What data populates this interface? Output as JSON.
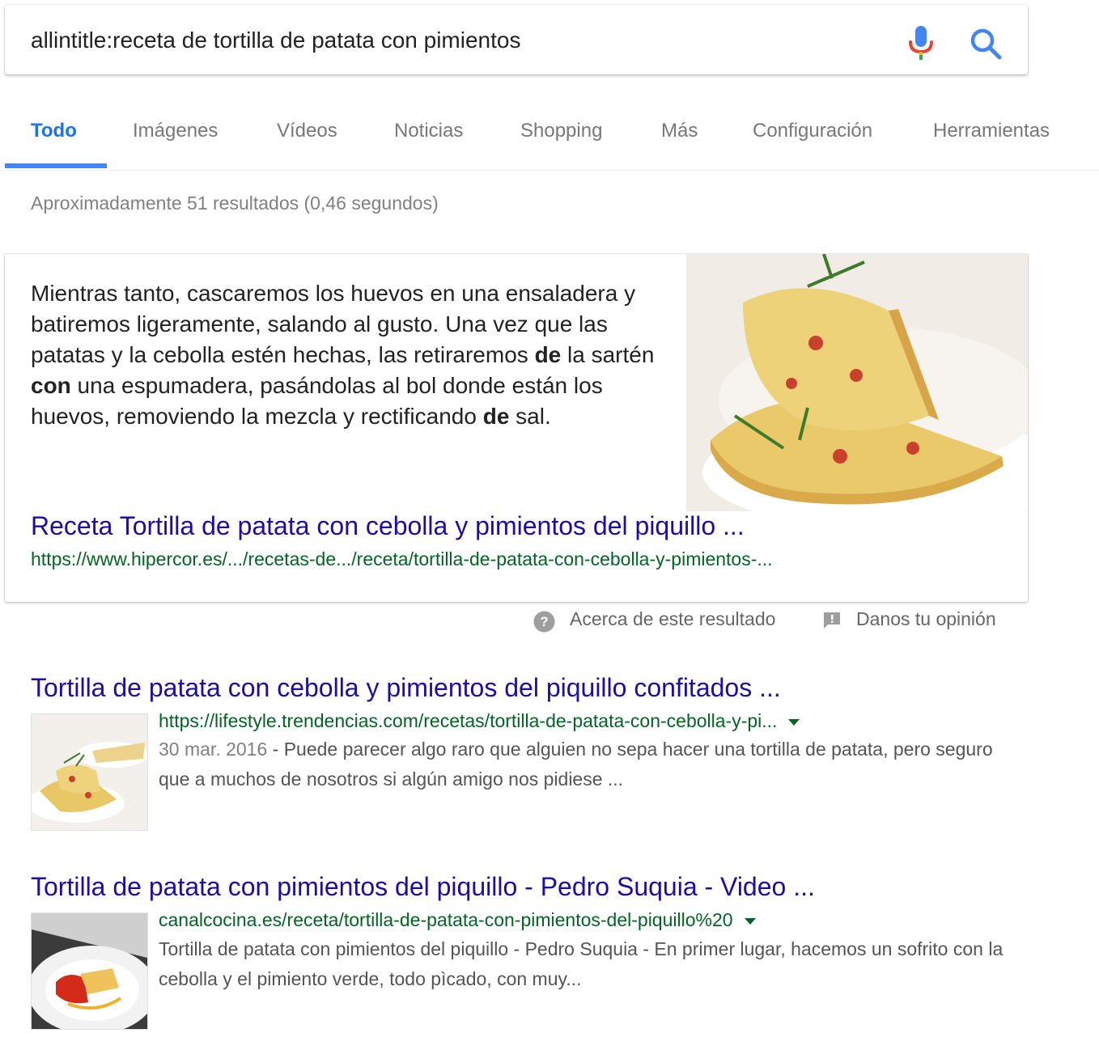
{
  "search": {
    "query": "allintitle:receta de tortilla de patata con pimientos"
  },
  "tabs": [
    {
      "label": "Todo",
      "active": true
    },
    {
      "label": "Imágenes"
    },
    {
      "label": "Vídeos"
    },
    {
      "label": "Noticias"
    },
    {
      "label": "Shopping"
    },
    {
      "label": "Más"
    },
    {
      "label": "Configuración"
    },
    {
      "label": "Herramientas"
    }
  ],
  "stats": "Aproximadamente 51 resultados (0,46 segundos)",
  "featured_snippet": {
    "text_parts": [
      "Mientras tanto, cascaremos los huevos en una ensaladera y batiremos ligeramente, salando al gusto. Una vez que las patatas y la cebolla estén hechas, las retiraremos ",
      "de",
      " la sartén ",
      "con",
      " una espumadera, pasándolas al bol donde están los huevos, removiendo la mezcla y rectificando ",
      "de",
      " sal."
    ],
    "title": "Receta Tortilla de patata con cebolla y pimientos del piquillo ...",
    "url": "https://www.hipercor.es/.../recetas-de.../receta/tortilla-de-patata-con-cebolla-y-pimientos-..."
  },
  "about": {
    "about_label": "Acerca de este resultado",
    "feedback_label": "Danos tu opinión"
  },
  "results": [
    {
      "title": "Tortilla de patata con cebolla y pimientos del piquillo confitados ...",
      "url": "https://lifestyle.trendencias.com/recetas/tortilla-de-patata-con-cebolla-y-pi...",
      "date": "30 mar. 2016",
      "separator": " - ",
      "description": "Puede parecer algo raro que alguien no sepa hacer una tortilla de patata, pero seguro que a muchos de nosotros si algún amigo nos pidiese ..."
    },
    {
      "title": "Tortilla de patata con pimientos del piquillo - Pedro Suquia - Video ...",
      "url": "canalcocina.es/receta/tortilla-de-patata-con-pimientos-del-piquillo%20",
      "description": "Tortilla de patata con pimientos del piquillo - Pedro Suquia - En primer lugar, hacemos un sofrito con la cebolla y el pimiento verde, todo pìcado, con muy..."
    }
  ],
  "colors": {
    "link": "#1a0dab",
    "url": "#006621",
    "accent": "#4285f4"
  }
}
